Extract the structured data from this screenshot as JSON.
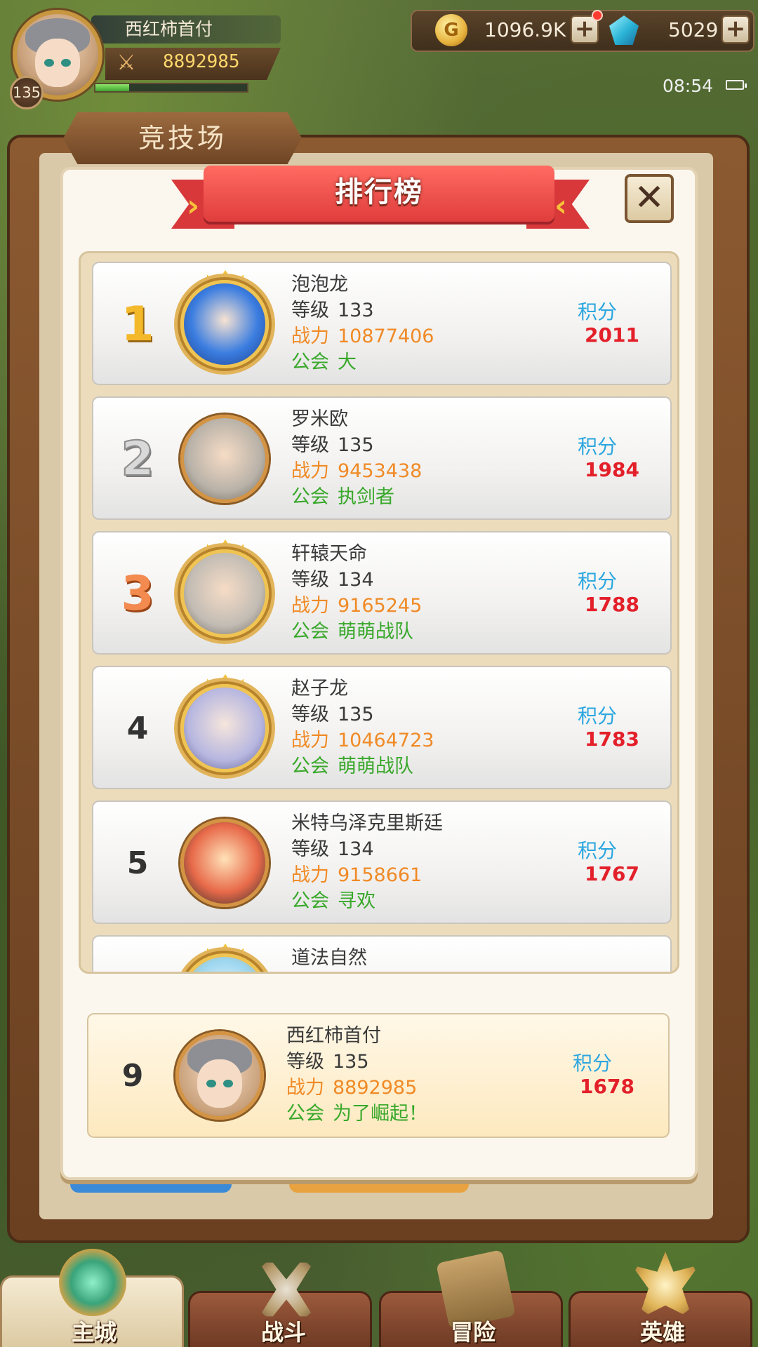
{
  "player": {
    "name": "西红柿首付",
    "level": "135",
    "power": "8892985",
    "xp_fraction": 0.22
  },
  "resources": {
    "coins": "1096.9K",
    "coin_glyph": "G",
    "gems": "5029",
    "plus": "+"
  },
  "status": {
    "time": "08:54"
  },
  "arena": {
    "tab_title": "竞技场"
  },
  "leaderboard": {
    "title": "排行榜",
    "close": "✕",
    "labels": {
      "level": "等级",
      "power": "战力",
      "guild": "公会",
      "score": "积分"
    },
    "rows": [
      {
        "rank": "1",
        "name": "泡泡龙",
        "level": "133",
        "power": "10877406",
        "guild": "大",
        "score": "2011"
      },
      {
        "rank": "2",
        "name": "罗米欧",
        "level": "135",
        "power": "9453438",
        "guild": "执剑者",
        "score": "1984"
      },
      {
        "rank": "3",
        "name": "轩辕天命",
        "level": "134",
        "power": "9165245",
        "guild": "萌萌战队",
        "score": "1788"
      },
      {
        "rank": "4",
        "name": "赵子龙",
        "level": "135",
        "power": "10464723",
        "guild": "萌萌战队",
        "score": "1783"
      },
      {
        "rank": "5",
        "name": "米特乌泽克里斯廷",
        "level": "134",
        "power": "9158661",
        "guild": "寻欢",
        "score": "1767"
      },
      {
        "rank": "",
        "name": "道法自然",
        "level": "",
        "power": "",
        "guild": "",
        "score": ""
      }
    ],
    "me": {
      "rank": "9",
      "name": "西红柿首付",
      "level": "135",
      "power": "8892985",
      "guild": "为了崛起！",
      "score": "1678"
    }
  },
  "nav": {
    "tabs": [
      {
        "label": "主城",
        "icon": "city-icon"
      },
      {
        "label": "战斗",
        "icon": "swords-icon"
      },
      {
        "label": "冒险",
        "icon": "scroll-icon"
      },
      {
        "label": "英雄",
        "icon": "hero-icon"
      }
    ]
  },
  "colors": {
    "power": "#f08a26",
    "guild": "#39a82b",
    "score_label": "#2ba6df",
    "score_value": "#e3202a",
    "ribbon": "#e03d3d"
  }
}
